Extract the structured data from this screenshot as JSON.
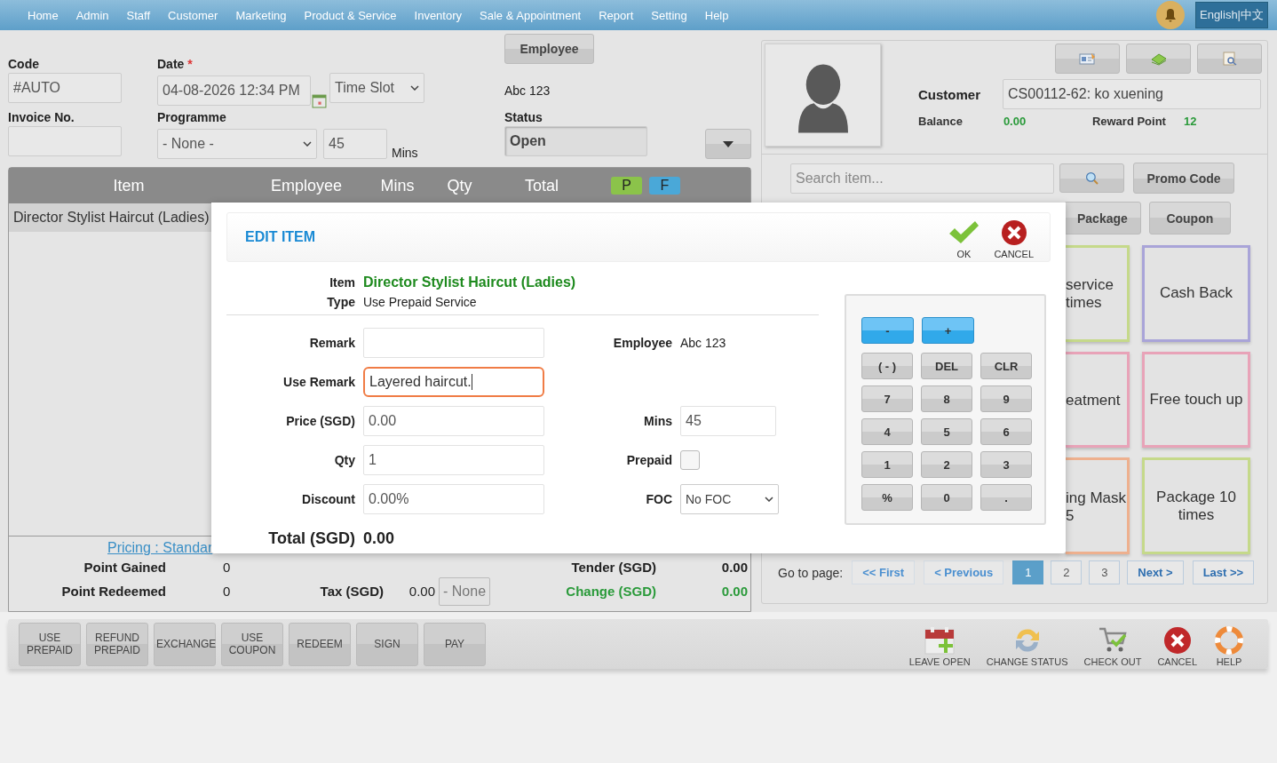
{
  "nav": {
    "items": [
      "Home",
      "Admin",
      "Staff",
      "Customer",
      "Marketing",
      "Product & Service",
      "Inventory",
      "Sale & Appointment",
      "Report",
      "Setting",
      "Help"
    ],
    "language": "English|中文"
  },
  "form": {
    "code_label": "Code",
    "code_value": "#AUTO",
    "date_label": "Date",
    "required_mark": "*",
    "date_value": "04-08-2026 12:34 PM",
    "time_slot": "Time Slot",
    "employee_button": "Employee",
    "employee_value": "Abc 123",
    "invoice_label": "Invoice No.",
    "programme_label": "Programme",
    "programme_value": "- None -",
    "mins_value": "45",
    "mins_unit": "Mins",
    "status_label": "Status",
    "status_value": "Open"
  },
  "table": {
    "columns": [
      "Item",
      "Employee",
      "Mins",
      "Qty",
      "Total"
    ],
    "badges": [
      {
        "label": "P",
        "color": "#8bc34a"
      },
      {
        "label": "F",
        "color": "#4aa8d8"
      }
    ],
    "rows": [
      {
        "item": "Director Stylist Haircut (Ladies)",
        "selected": true
      }
    ]
  },
  "summary": {
    "pricing_link": "Pricing : Standar",
    "point_gained_label": "Point Gained",
    "point_gained": "0",
    "tender_label": "Tender (SGD)",
    "tender": "0.00",
    "point_redeemed_label": "Point Redeemed",
    "point_redeemed": "0",
    "tax_label": "Tax (SGD)",
    "tax": "0.00",
    "tax_select": "- None",
    "change_label": "Change (SGD)",
    "change": "0.00"
  },
  "customer": {
    "label": "Customer",
    "value": "CS00112-62: ko xuening",
    "balance_label": "Balance",
    "balance": "0.00",
    "reward_label": "Reward Point",
    "reward": "12"
  },
  "search": {
    "placeholder": "Search item...",
    "promo_button": "Promo Code"
  },
  "categories": [
    "Package",
    "Coupon"
  ],
  "tiles": [
    [
      {
        "label": "service times",
        "color": "#c5d98a"
      },
      {
        "label": "eatment",
        "color": "#e8a3b8"
      },
      {
        "label": "ing Mask 5",
        "color": "#eeb08e"
      }
    ],
    [
      {
        "label": "Cash Back",
        "color": "#a9a4d8"
      },
      {
        "label": "Free touch up",
        "color": "#e8a3b8"
      },
      {
        "label": "Package 10 times",
        "color": "#c5d98a"
      }
    ]
  ],
  "pagination": {
    "label": "Go to page:",
    "first": "<< First",
    "previous": "< Previous",
    "pages": [
      {
        "label": "1",
        "selected": true
      },
      {
        "label": "2",
        "selected": false
      },
      {
        "label": "3",
        "selected": false
      }
    ],
    "next": "Next >",
    "last": "Last >>"
  },
  "left_actions": [
    "USE PREPAID",
    "REFUND PREPAID",
    "EXCHANGE",
    "USE COUPON",
    "REDEEM",
    "SIGN",
    "PAY"
  ],
  "right_actions": [
    {
      "kind": "calendar",
      "label": "LEAVE OPEN"
    },
    {
      "kind": "refresh",
      "label": "CHANGE STATUS"
    },
    {
      "kind": "cart",
      "label": "CHECK OUT"
    },
    {
      "kind": "cancel",
      "label": "CANCEL"
    },
    {
      "kind": "help",
      "label": "HELP"
    }
  ],
  "modal": {
    "title": "EDIT ITEM",
    "ok": "OK",
    "cancel": "CANCEL",
    "item_label": "Item",
    "item_value": "Director Stylist Haircut (Ladies)",
    "type_label": "Type",
    "type_value": "Use Prepaid Service",
    "rows": [
      {
        "left": {
          "label": "Remark",
          "focused": false
        },
        "right": {
          "kind": "text",
          "label": "Employee",
          "value": "Abc 123"
        }
      },
      {
        "left": {
          "label": "Use Remark",
          "value": "Layered haircut.",
          "focused": true
        }
      },
      {
        "left": {
          "label": "Price (SGD)",
          "value": "0.00",
          "focused": false
        },
        "right": {
          "kind": "input",
          "label": "Mins",
          "value": "45"
        }
      },
      {
        "left": {
          "label": "Qty",
          "value": "1",
          "focused": false
        },
        "right": {
          "kind": "checkbox",
          "label": "Prepaid",
          "checked": false
        }
      },
      {
        "left": {
          "label": "Discount",
          "value": "0.00%",
          "focused": false
        },
        "right": {
          "kind": "select",
          "label": "FOC",
          "value": "No FOC"
        }
      }
    ],
    "total_label": "Total (SGD)",
    "total_value": "0.00",
    "keypad": [
      [
        {
          "label": "-",
          "kind": "step"
        },
        {
          "label": "+",
          "kind": "step"
        }
      ],
      [
        {
          "label": "( - )",
          "kind": "key"
        },
        {
          "label": "DEL",
          "kind": "key"
        },
        {
          "label": "CLR",
          "kind": "key"
        }
      ],
      [
        {
          "label": "7",
          "kind": "key"
        },
        {
          "label": "8",
          "kind": "key"
        },
        {
          "label": "9",
          "kind": "key"
        }
      ],
      [
        {
          "label": "4",
          "kind": "key"
        },
        {
          "label": "5",
          "kind": "key"
        },
        {
          "label": "6",
          "kind": "key"
        }
      ],
      [
        {
          "label": "1",
          "kind": "key"
        },
        {
          "label": "2",
          "kind": "key"
        },
        {
          "label": "3",
          "kind": "key"
        }
      ],
      [
        {
          "label": "%",
          "kind": "key"
        },
        {
          "label": "0",
          "kind": "key"
        },
        {
          "label": ".",
          "kind": "key"
        }
      ]
    ]
  }
}
